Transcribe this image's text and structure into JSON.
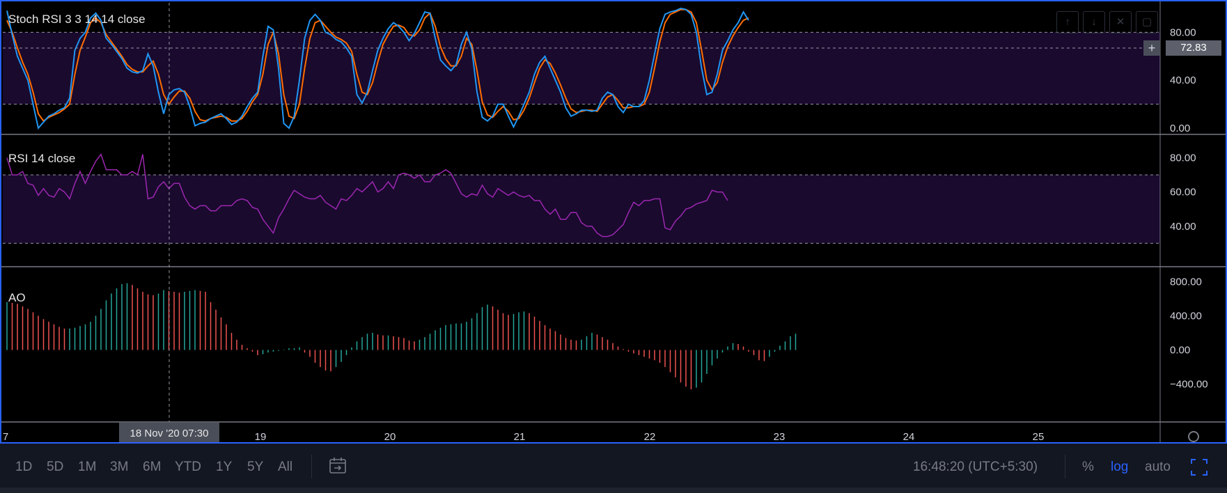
{
  "stoch_pane": {
    "title": "Stoch RSI 3 3 14 14 close",
    "axis_labels": [
      "80.00",
      "40.00",
      "0.00"
    ],
    "current_value": "72.83",
    "plus_label": "+",
    "controls": [
      "↑",
      "↓",
      "✕",
      "▢"
    ]
  },
  "rsi_pane": {
    "title": "RSI 14 close",
    "axis_labels": [
      "80.00",
      "60.00",
      "40.00"
    ]
  },
  "ao_pane": {
    "title": "AO",
    "axis_labels": [
      "800.00",
      "400.00",
      "0.00",
      "−400.00"
    ]
  },
  "time_axis": {
    "labels": [
      "7",
      "19",
      "20",
      "21",
      "22",
      "23",
      "24",
      "25"
    ],
    "crosshair_label": "18 Nov '20   07:30"
  },
  "toolbar": {
    "ranges": [
      "1D",
      "5D",
      "1M",
      "3M",
      "6M",
      "YTD",
      "1Y",
      "5Y",
      "All"
    ],
    "clock": "16:48:20 (UTC+5:30)",
    "percent": "%",
    "log": "log",
    "auto": "auto"
  },
  "colors": {
    "background": "#000000",
    "band_fill": "#1a0a2e",
    "stoch_k": "#2196f3",
    "stoch_d": "#ff6d00",
    "rsi_line": "#9c27b0",
    "ao_up": "#26a69a",
    "ao_down": "#ef5350",
    "accent": "#2962ff"
  },
  "chart_data": [
    {
      "type": "line",
      "title": "Stoch RSI 3 3 14 14 close",
      "x_range": [
        "17 Nov",
        "25 Nov"
      ],
      "ylim": [
        0,
        100
      ],
      "bands": [
        20,
        80
      ],
      "series": [
        {
          "name": "K",
          "values": [
            98,
            78,
            60,
            50,
            40,
            20,
            0,
            5,
            10,
            12,
            15,
            17,
            25,
            65,
            75,
            80,
            92,
            96,
            90,
            75,
            70,
            64,
            58,
            50,
            47,
            46,
            48,
            62,
            52,
            30,
            12,
            28,
            32,
            33,
            30,
            18,
            2,
            4,
            5,
            8,
            10,
            12,
            8,
            3,
            5,
            10,
            18,
            25,
            30,
            60,
            85,
            82,
            50,
            4,
            0,
            10,
            40,
            75,
            90,
            95,
            90,
            80,
            78,
            74,
            72,
            67,
            60,
            28,
            21,
            30,
            48,
            65,
            75,
            83,
            88,
            85,
            80,
            73,
            79,
            88,
            97,
            96,
            75,
            57,
            52,
            48,
            53,
            70,
            80,
            66,
            30,
            9,
            6,
            10,
            20,
            20,
            10,
            1,
            10,
            20,
            30,
            45,
            55,
            60,
            50,
            40,
            30,
            17,
            10,
            12,
            15,
            15,
            14,
            15,
            25,
            30,
            28,
            18,
            13,
            20,
            18,
            18,
            23,
            40,
            62,
            83,
            95,
            97,
            98,
            100,
            99,
            95,
            80,
            50,
            28,
            30,
            45,
            65,
            73,
            82,
            88,
            97,
            90
          ]
        },
        {
          "name": "D",
          "values": [
            90,
            80,
            67,
            55,
            45,
            30,
            12,
            6,
            9,
            11,
            13,
            16,
            20,
            45,
            65,
            76,
            88,
            92,
            88,
            78,
            72,
            66,
            60,
            53,
            49,
            47,
            47,
            52,
            56,
            45,
            28,
            20,
            26,
            31,
            31,
            25,
            14,
            7,
            6,
            8,
            9,
            10,
            9,
            6,
            6,
            8,
            14,
            22,
            28,
            45,
            70,
            80,
            62,
            28,
            10,
            8,
            20,
            50,
            75,
            88,
            90,
            85,
            80,
            76,
            74,
            71,
            64,
            45,
            30,
            28,
            38,
            55,
            70,
            78,
            85,
            86,
            84,
            78,
            77,
            82,
            92,
            96,
            85,
            68,
            58,
            52,
            52,
            60,
            75,
            70,
            48,
            22,
            11,
            9,
            14,
            18,
            14,
            7,
            8,
            15,
            25,
            38,
            50,
            57,
            54,
            46,
            36,
            25,
            16,
            13,
            14,
            15,
            15,
            14,
            20,
            26,
            28,
            23,
            17,
            17,
            18,
            18,
            20,
            30,
            50,
            72,
            88,
            95,
            97,
            99,
            99,
            97,
            88,
            65,
            40,
            32,
            38,
            55,
            68,
            77,
            84,
            90,
            92
          ]
        }
      ]
    },
    {
      "type": "line",
      "title": "RSI 14 close",
      "ylim": [
        20,
        90
      ],
      "bands": [
        30,
        70
      ],
      "series": [
        {
          "name": "RSI",
          "values": [
            80,
            70,
            70,
            72,
            65,
            64,
            58,
            62,
            58,
            57,
            62,
            60,
            56,
            65,
            72,
            65,
            72,
            78,
            82,
            73,
            73,
            73,
            70,
            70,
            72,
            70,
            82,
            56,
            57,
            63,
            66,
            62,
            65,
            65,
            57,
            52,
            50,
            52,
            52,
            49,
            49,
            52,
            52,
            52,
            55,
            56,
            55,
            51,
            50,
            44,
            40,
            36,
            45,
            50,
            56,
            61,
            59,
            57,
            56,
            56,
            58,
            54,
            52,
            50,
            56,
            55,
            58,
            62,
            60,
            63,
            66,
            60,
            62,
            66,
            62,
            70,
            71,
            70,
            68,
            70,
            66,
            66,
            70,
            71,
            73,
            71,
            65,
            59,
            57,
            59,
            58,
            64,
            59,
            57,
            62,
            60,
            58,
            60,
            58,
            57,
            58,
            55,
            55,
            50,
            47,
            50,
            44,
            44,
            48,
            48,
            42,
            40,
            40,
            36,
            34,
            34,
            35,
            38,
            41,
            48,
            54,
            52,
            55,
            55,
            56,
            56,
            39,
            38,
            43,
            46,
            50,
            51,
            53,
            54,
            55,
            61,
            60,
            60,
            55
          ]
        }
      ]
    },
    {
      "type": "bar",
      "title": "AO",
      "ylim": [
        -500,
        900
      ],
      "series": [
        {
          "name": "AO",
          "values": [
            560,
            550,
            540,
            510,
            480,
            440,
            400,
            360,
            330,
            300,
            270,
            250,
            250,
            260,
            280,
            300,
            330,
            400,
            480,
            580,
            660,
            720,
            770,
            780,
            760,
            720,
            680,
            650,
            640,
            660,
            700,
            690,
            680,
            670,
            680,
            690,
            700,
            690,
            680,
            560,
            470,
            380,
            300,
            200,
            120,
            60,
            20,
            -20,
            -60,
            -50,
            -30,
            -20,
            -10,
            5,
            20,
            20,
            30,
            -30,
            -80,
            -150,
            -200,
            -240,
            -250,
            -200,
            -140,
            -60,
            30,
            100,
            150,
            190,
            200,
            180,
            170,
            170,
            160,
            150,
            140,
            110,
            100,
            120,
            150,
            190,
            230,
            260,
            290,
            300,
            310,
            310,
            330,
            370,
            430,
            500,
            530,
            510,
            470,
            430,
            410,
            420,
            440,
            450,
            430,
            390,
            340,
            290,
            250,
            220,
            180,
            140,
            120,
            110,
            120,
            160,
            200,
            180,
            150,
            120,
            80,
            40,
            10,
            -20,
            -40,
            -60,
            -80,
            -100,
            -120,
            -150,
            -200,
            -260,
            -320,
            -380,
            -430,
            -460,
            -440,
            -380,
            -280,
            -180,
            -100,
            -30,
            40,
            80,
            70,
            40,
            -20,
            -60,
            -120,
            -130,
            -80,
            -20,
            50,
            100,
            160,
            190
          ]
        }
      ]
    }
  ]
}
